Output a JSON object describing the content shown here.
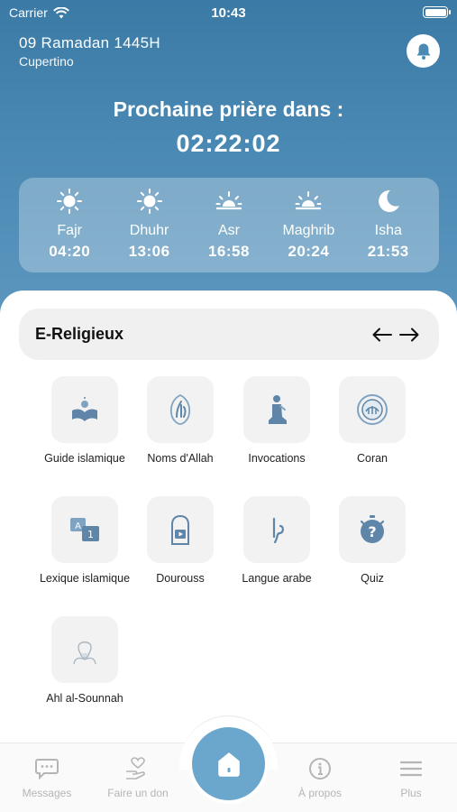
{
  "status": {
    "carrier": "Carrier",
    "time": "10:43"
  },
  "header": {
    "date": "09 Ramadan 1445H",
    "city": "Cupertino",
    "next_label": "Prochaine prière dans :",
    "countdown": "02:22:02"
  },
  "prayers": [
    {
      "name": "Fajr",
      "time": "04:20",
      "icon": "sun-icon"
    },
    {
      "name": "Dhuhr",
      "time": "13:06",
      "icon": "sun-icon"
    },
    {
      "name": "Asr",
      "time": "16:58",
      "icon": "sunset-icon"
    },
    {
      "name": "Maghrib",
      "time": "20:24",
      "icon": "sunset-icon"
    },
    {
      "name": "Isha",
      "time": "21:53",
      "icon": "moon-icon"
    }
  ],
  "section": {
    "title": "E-Religieux"
  },
  "tiles": [
    {
      "label": "Guide islamique",
      "icon": "open-book-icon"
    },
    {
      "label": "Noms d'Allah",
      "icon": "calligraphy-icon"
    },
    {
      "label": "Invocations",
      "icon": "praying-person-icon"
    },
    {
      "label": "Coran",
      "icon": "quran-medallion-icon"
    },
    {
      "label": "Lexique islamique",
      "icon": "translate-icon"
    },
    {
      "label": "Dourouss",
      "icon": "video-lesson-icon"
    },
    {
      "label": "Langue arabe",
      "icon": "arabic-letter-icon"
    },
    {
      "label": "Quiz",
      "icon": "stopwatch-question-icon"
    },
    {
      "label": "Ahl al-Sounnah",
      "icon": "scholar-sketch-icon"
    }
  ],
  "tabbar": {
    "messages": "Messages",
    "donate": "Faire un don",
    "about": "À propos",
    "more": "Plus"
  },
  "colors": {
    "header": "#4a89b3",
    "accent": "#6ba7cc",
    "tile_icon": "#5f86a8"
  }
}
